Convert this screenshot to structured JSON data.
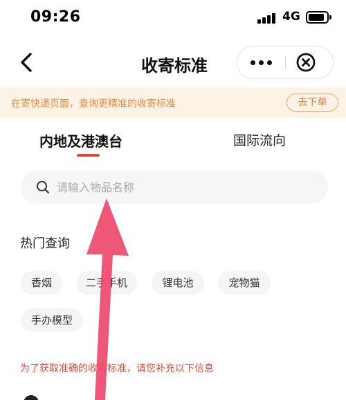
{
  "status_bar": {
    "time": "09:26",
    "network": "4G"
  },
  "nav": {
    "title": "收寄标准"
  },
  "icons": {
    "back": "chevron-left-icon",
    "more": "more-dots-icon",
    "close": "circle-close-icon",
    "search": "search-icon",
    "signal": "signal-bars-icon",
    "battery": "battery-icon",
    "arrow": "pointer-arrow-annotation"
  },
  "banner": {
    "text": "在寄快递页面，查询更精准的收寄标准",
    "button_label": "去下单"
  },
  "tabs": {
    "active": "内地及港澳台",
    "other": "国际流向"
  },
  "search": {
    "placeholder": "请输入物品名称",
    "value": ""
  },
  "hot": {
    "title": "热门查询",
    "items": [
      "香烟",
      "二手手机",
      "锂电池",
      "宠物猫",
      "手办模型"
    ]
  },
  "notice": "为了获取准确的收寄标准，请您补充以下信息",
  "colors": {
    "accent_red": "#e24736",
    "banner_bg": "#fdf2e6",
    "banner_text": "#e9893e",
    "annotation_arrow": "#ee4a6e"
  }
}
